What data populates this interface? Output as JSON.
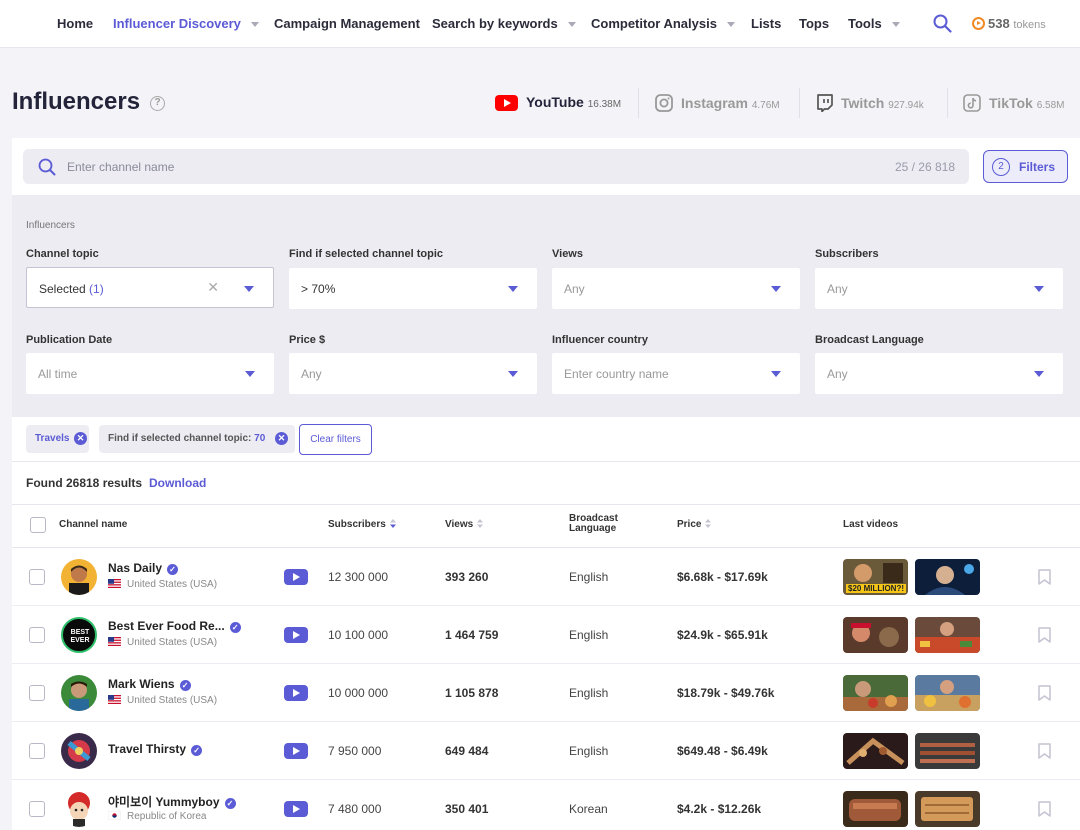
{
  "nav": {
    "items": [
      "Home",
      "Influencer Discovery",
      "Campaign Management",
      "Search by keywords",
      "Competitor Analysis",
      "Lists",
      "Tops",
      "Tools"
    ],
    "tokens_count": "538",
    "tokens_label": "tokens"
  },
  "page": {
    "title": "Influencers",
    "help_label": "?"
  },
  "platforms": [
    {
      "name": "YouTube",
      "count": "16.38M",
      "icon": "youtube-icon"
    },
    {
      "name": "Instagram",
      "count": "4.76M",
      "icon": "instagram-icon"
    },
    {
      "name": "Twitch",
      "count": "927.94k",
      "icon": "twitch-icon"
    },
    {
      "name": "TikTok",
      "count": "6.58M",
      "icon": "tiktok-icon"
    }
  ],
  "search": {
    "placeholder": "Enter channel name",
    "count": "25 / 26 818"
  },
  "filters_button": {
    "badge": "2",
    "label": "Filters"
  },
  "filters": {
    "section_label": "Influencers",
    "channel_topic": {
      "label": "Channel topic",
      "value": "Selected",
      "count": "(1)"
    },
    "find_topic": {
      "label": "Find if selected channel topic",
      "value": "> 70%"
    },
    "views": {
      "label": "Views",
      "value": "Any"
    },
    "subscribers": {
      "label": "Subscribers",
      "value": "Any"
    },
    "publication_date": {
      "label": "Publication Date",
      "value": "All time"
    },
    "price": {
      "label": "Price $",
      "value": "Any"
    },
    "country": {
      "label": "Influencer country",
      "value": "Enter country name"
    },
    "language": {
      "label": "Broadcast Language",
      "value": "Any"
    }
  },
  "chips": [
    {
      "label": "Travels"
    },
    {
      "label": "Find if selected channel topic:",
      "value": "70"
    }
  ],
  "clear_filters": "Clear filters",
  "results": {
    "found": "Found 26818 results",
    "download": "Download"
  },
  "table": {
    "headers": {
      "channel": "Channel name",
      "subscribers": "Subscribers",
      "views": "Views",
      "language_line1": "Broadcast",
      "language_line2": "Language",
      "price": "Price",
      "last_videos": "Last videos"
    },
    "rows": [
      {
        "name": "Nas Daily",
        "country": "United States (USA)",
        "subscribers": "12 300 000",
        "views": "393 260",
        "language": "English",
        "price": "$6.68k - $17.69k",
        "thumb_text": "$20 MILLION?!"
      },
      {
        "name": "Best Ever Food Re...",
        "country": "United States (USA)",
        "subscribers": "10 100 000",
        "views": "1 464 759",
        "language": "English",
        "price": "$24.9k - $65.91k",
        "logo_text": "BEST EVER"
      },
      {
        "name": "Mark Wiens",
        "country": "United States (USA)",
        "subscribers": "10 000 000",
        "views": "1 105 878",
        "language": "English",
        "price": "$18.79k - $49.76k"
      },
      {
        "name": "Travel Thirsty",
        "country": "",
        "subscribers": "7 950 000",
        "views": "649 484",
        "language": "English",
        "price": "$649.48 - $6.49k"
      },
      {
        "name": "야미보이 Yummyboy",
        "country": "Republic of Korea",
        "subscribers": "7 480 000",
        "views": "350 401",
        "language": "Korean",
        "price": "$4.2k - $12.26k"
      }
    ]
  },
  "colors": {
    "accent": "#5b5bd6",
    "youtube": "#ff0000",
    "tokens": "#f08a24"
  }
}
